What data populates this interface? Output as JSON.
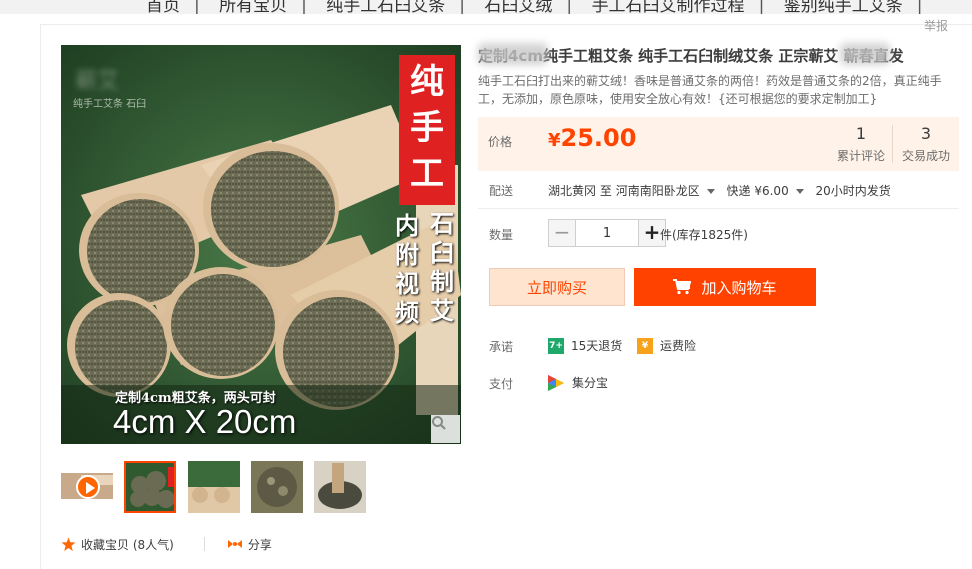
{
  "nav": {
    "items": [
      "首页",
      "所有宝贝",
      "纯手工石臼艾条",
      "石臼艾绒",
      "手工石臼艾制作过程",
      "鉴别纯手工艾条"
    ]
  },
  "report_label": "举报",
  "product": {
    "title": "定制4cm纯手工粗艾条 纯手工石臼制绒艾条 正宗蕲艾 蕲春直发",
    "subtitle": "纯手工石臼打出来的蕲艾绒！香味是普通艾条的两倍！药效是普通艾条的2倍，真正纯手工，无添加，原色原味，使用安全放心有效！{还可根据您的要求定制加工}"
  },
  "price": {
    "label": "价格",
    "currency": "¥",
    "value": "25.00",
    "reviews_count": "1",
    "reviews_label": "累计评论",
    "sales_count": "3",
    "sales_label": "交易成功"
  },
  "shipping": {
    "label": "配送",
    "from": "湖北黄冈",
    "to_word": "至",
    "to": "河南南阳卧龙区",
    "method": "快递 ¥6.00",
    "dispatch": "20小时内发货"
  },
  "quantity": {
    "label": "数量",
    "minus": "−",
    "value": "1",
    "plus": "+",
    "stock": "件(库存1825件)"
  },
  "buttons": {
    "buy_now": "立即购买",
    "add_cart": "加入购物车"
  },
  "promise": {
    "label": "承诺",
    "return_text": "15天退货",
    "insurance_text": "运费险"
  },
  "payment": {
    "label": "支付",
    "method": "集分宝"
  },
  "image": {
    "brand": "蕲艾",
    "brand_sub": "纯手工艾条 石臼",
    "banner": [
      "纯",
      "手",
      "工"
    ],
    "col_left": [
      "内",
      "附",
      "视",
      "频"
    ],
    "col_right": [
      "石",
      "臼",
      "制",
      "艾"
    ],
    "promo": "定制4cm粗艾条，两头可封",
    "size": "4cm X 20cm"
  },
  "gallery": {
    "favorite_text": "收藏宝贝 (8人气)",
    "share_text": "分享"
  },
  "colors": {
    "accent": "#ff4400",
    "price_bg": "#fff2e8",
    "image_bg": "#2f5a2f"
  }
}
